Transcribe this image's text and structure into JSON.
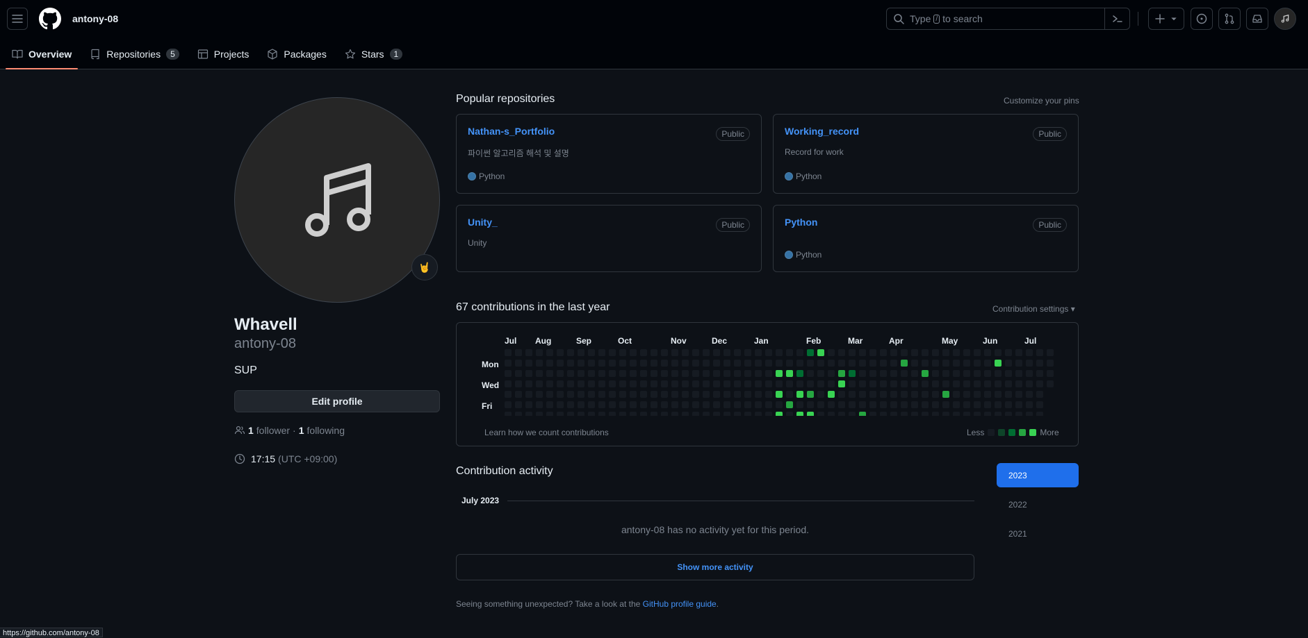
{
  "header": {
    "username": "antony-08",
    "search_prefix": "Type",
    "search_key": "/",
    "search_suffix": "to search"
  },
  "tabs": [
    {
      "label": "Overview",
      "count": ""
    },
    {
      "label": "Repositories",
      "count": "5"
    },
    {
      "label": "Projects",
      "count": ""
    },
    {
      "label": "Packages",
      "count": ""
    },
    {
      "label": "Stars",
      "count": "1"
    }
  ],
  "profile": {
    "name": "Whavell",
    "login": "antony-08",
    "bio": "SUP",
    "edit_label": "Edit profile",
    "emoji": "🤘",
    "followers": "1",
    "followers_label": "follower",
    "following": "1",
    "following_label": "following",
    "time": "17:15",
    "tz": "(UTC +09:00)"
  },
  "pinned": {
    "title": "Popular repositories",
    "customize": "Customize your pins",
    "repos": [
      {
        "name": "Nathan-s_Portfolio",
        "visibility": "Public",
        "description": "파이썬 알고리즘 해석 및 설명",
        "language": "Python"
      },
      {
        "name": "Working_record",
        "visibility": "Public",
        "description": "Record for work",
        "language": "Python"
      },
      {
        "name": "Unity_",
        "visibility": "Public",
        "description": "Unity",
        "language": ""
      },
      {
        "name": "Python",
        "visibility": "Public",
        "description": "",
        "language": "Python"
      }
    ]
  },
  "contributions": {
    "title": "67 contributions in the last year",
    "settings": "Contribution settings ▾",
    "months": [
      "Jul",
      "Aug",
      "Sep",
      "Oct",
      "Nov",
      "Dec",
      "Jan",
      "Feb",
      "Mar",
      "Apr",
      "May",
      "Jun",
      "Jul"
    ],
    "days": [
      "Mon",
      "Wed",
      "Fri"
    ],
    "learn": "Learn how we count contributions",
    "less": "Less",
    "more": "More",
    "weeks": 53,
    "active_cells": [
      {
        "week": 26,
        "day": 2,
        "level": 4
      },
      {
        "week": 26,
        "day": 4,
        "level": 4
      },
      {
        "week": 26,
        "day": 6,
        "level": 4
      },
      {
        "week": 27,
        "day": 2,
        "level": 4
      },
      {
        "week": 27,
        "day": 5,
        "level": 3
      },
      {
        "week": 28,
        "day": 2,
        "level": 2
      },
      {
        "week": 28,
        "day": 4,
        "level": 4
      },
      {
        "week": 28,
        "day": 6,
        "level": 4
      },
      {
        "week": 29,
        "day": 0,
        "level": 2
      },
      {
        "week": 29,
        "day": 4,
        "level": 3
      },
      {
        "week": 29,
        "day": 6,
        "level": 4
      },
      {
        "week": 30,
        "day": 0,
        "level": 4
      },
      {
        "week": 31,
        "day": 4,
        "level": 4
      },
      {
        "week": 32,
        "day": 2,
        "level": 3
      },
      {
        "week": 32,
        "day": 3,
        "level": 4
      },
      {
        "week": 33,
        "day": 2,
        "level": 2
      },
      {
        "week": 34,
        "day": 6,
        "level": 3
      },
      {
        "week": 38,
        "day": 1,
        "level": 3
      },
      {
        "week": 40,
        "day": 2,
        "level": 3
      },
      {
        "week": 42,
        "day": 4,
        "level": 3
      },
      {
        "week": 47,
        "day": 1,
        "level": 4
      }
    ],
    "colors": [
      "#161b22",
      "#0e4429",
      "#006d32",
      "#26a641",
      "#39d353"
    ]
  },
  "activity": {
    "title": "Contribution activity",
    "years": [
      "2023",
      "2022",
      "2021"
    ],
    "selected_year": "2023",
    "month": "July 2023",
    "empty": "antony-08 has no activity yet for this period.",
    "show_more": "Show more activity",
    "guide_prefix": "Seeing something unexpected? Take a look at the",
    "guide_link": "GitHub profile guide",
    "guide_suffix": "."
  },
  "status_url": "https://github.com/antony-08"
}
